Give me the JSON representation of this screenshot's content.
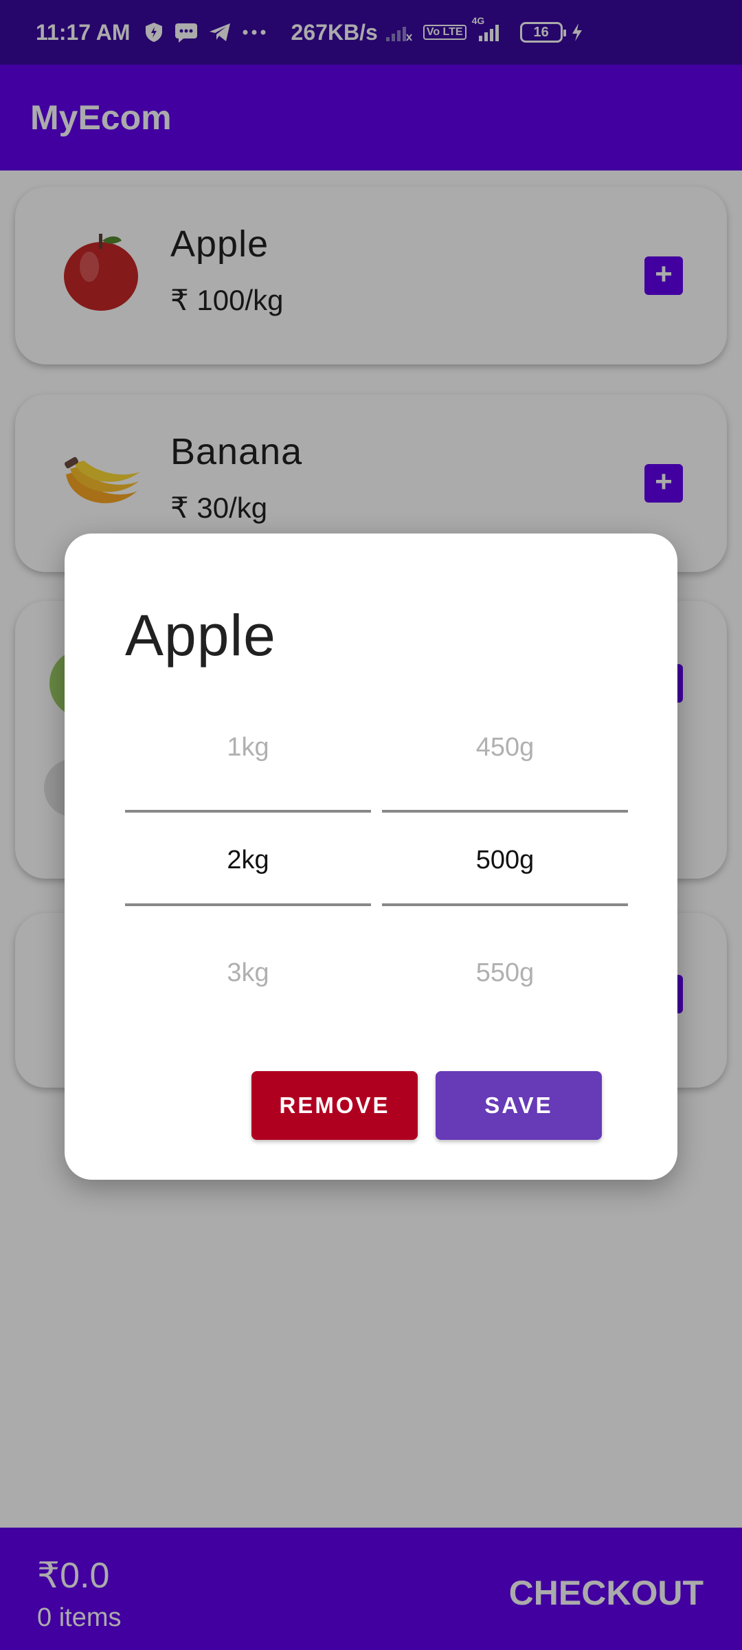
{
  "status_bar": {
    "time": "11:17 AM",
    "speed": "267KB/s",
    "volte": "Vo LTE",
    "network": "4G",
    "battery": "16"
  },
  "app_bar": {
    "title": "MyEcom"
  },
  "products": [
    {
      "name": "Apple",
      "price": "₹ 100/kg"
    },
    {
      "name": "Banana",
      "price": "₹ 30/kg"
    }
  ],
  "add_label": "+",
  "bottom_bar": {
    "total": "₹0.0",
    "items": "0 items",
    "checkout": "CHECKOUT"
  },
  "dialog": {
    "title": "Apple",
    "kg_picker": {
      "prev": "1kg",
      "selected": "2kg",
      "next": "3kg"
    },
    "g_picker": {
      "prev": "450g",
      "selected": "500g",
      "next": "550g"
    },
    "remove_label": "REMOVE",
    "save_label": "SAVE"
  },
  "colors": {
    "primary": "#6200ee",
    "status_bar": "#3a0a9e",
    "remove": "#b00020",
    "save": "#673ab7"
  }
}
